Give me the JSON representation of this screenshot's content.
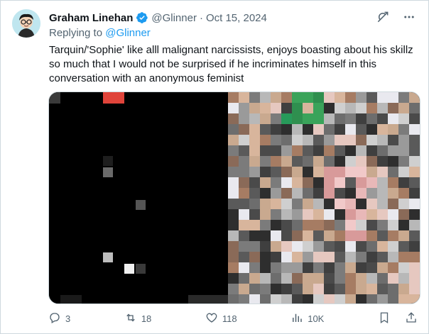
{
  "tweet": {
    "author_name": "Graham Linehan",
    "handle": "@Glinner",
    "separator": "·",
    "date": "Oct 15, 2024",
    "replying_label": "Replying to",
    "replying_handle": "@Glinner",
    "text": "Tarquin/'Sophie' like alll malignant narcissists, enjoys boasting about his skillz so much that I would not be surprised if he incriminates himself in this conversation with an anonymous feminist"
  },
  "icons": {
    "verified": "verified-badge-icon",
    "grok": "grok-icon",
    "more": "more-icon",
    "reply": "reply-icon",
    "retweet": "retweet-icon",
    "like": "like-icon",
    "views": "views-icon",
    "bookmark": "bookmark-icon",
    "share": "share-icon"
  },
  "actions": {
    "replies": "3",
    "retweets": "18",
    "likes": "118",
    "views": "10K"
  },
  "colors": {
    "text": "#0f1419",
    "secondary": "#536471",
    "accent": "#1d9bf0",
    "border": "#cfd9de"
  }
}
